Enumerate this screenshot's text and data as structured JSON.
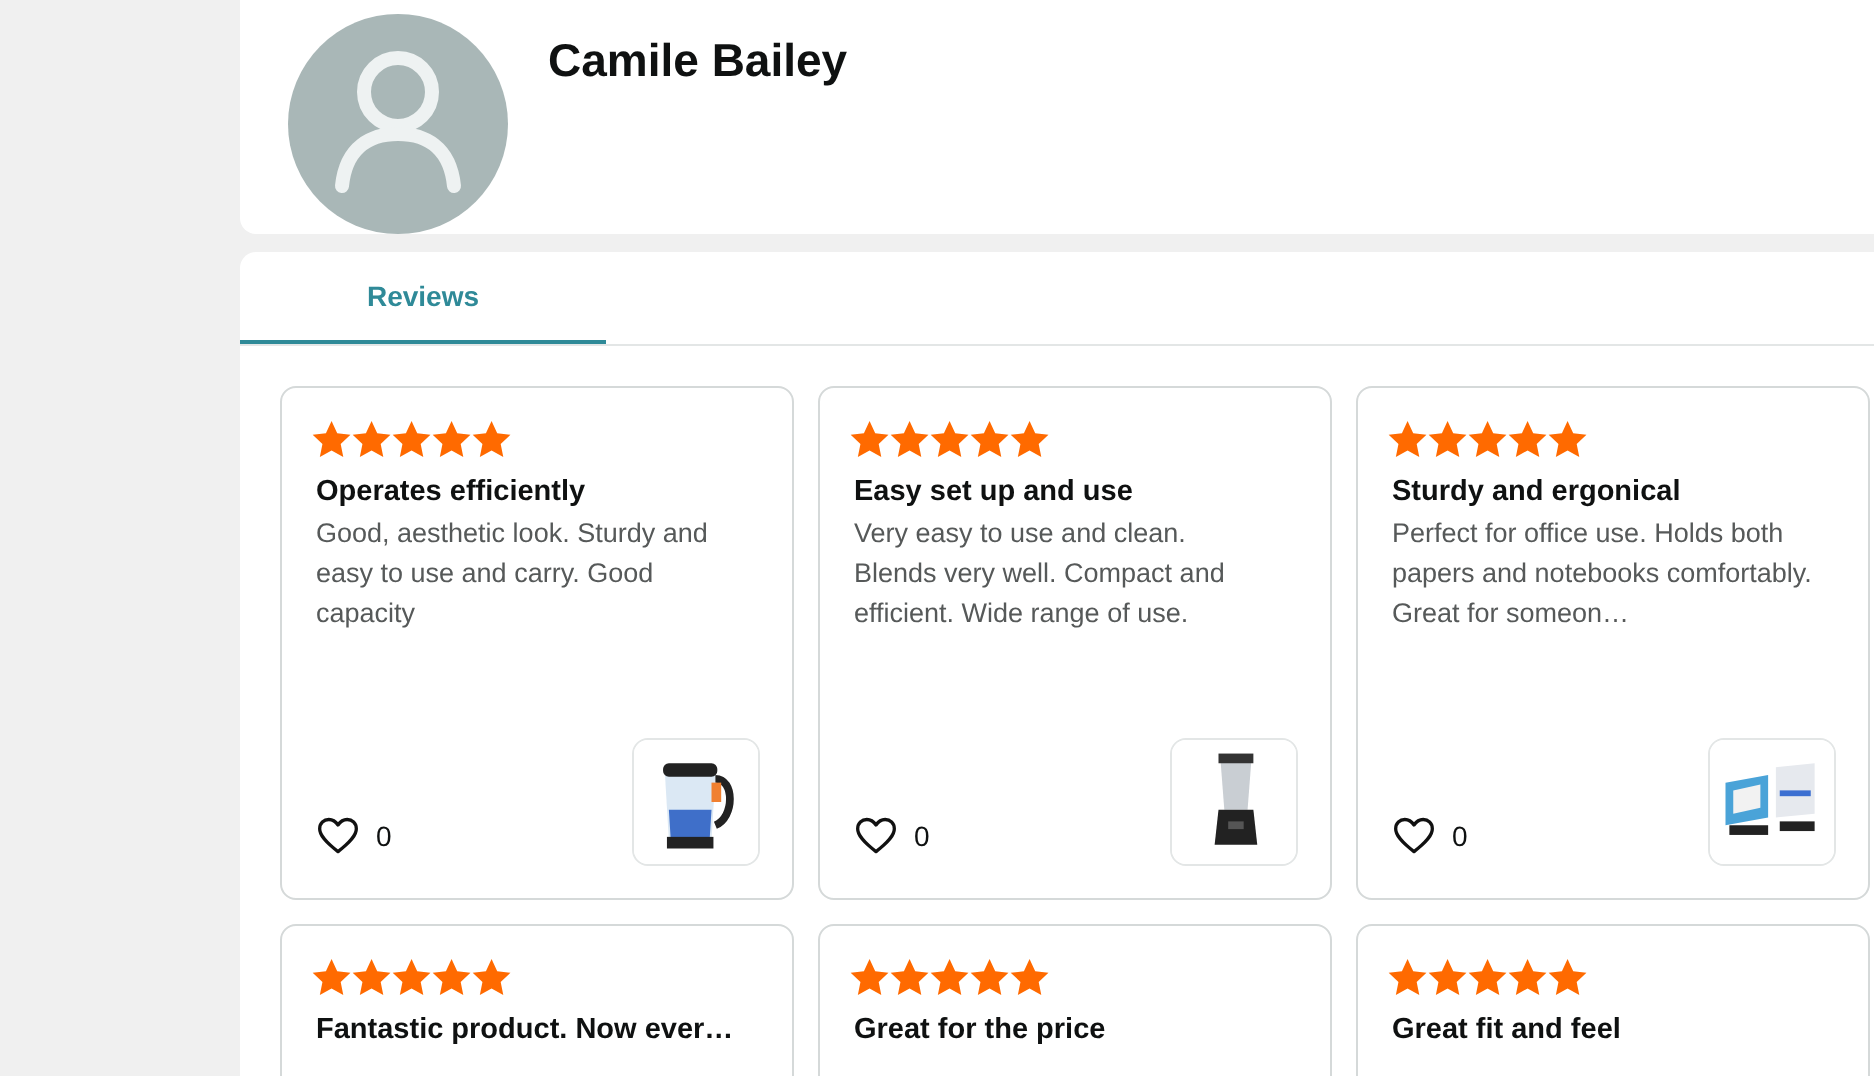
{
  "profile": {
    "name": "Camile Bailey"
  },
  "tabs": [
    {
      "label": "Reviews",
      "selected": true
    }
  ],
  "reviews": [
    {
      "stars": 5,
      "title": "Operates efficiently",
      "body": "Good, aesthetic look. Sturdy and easy to use and carry. Good capacity",
      "likes": "0"
    },
    {
      "stars": 5,
      "title": "Easy set up and use",
      "body": "Very easy to use and clean. Blends very well. Compact and efficient. Wide range of use.",
      "likes": "0"
    },
    {
      "stars": 5,
      "title": "Sturdy and ergonical",
      "body": "Perfect for office use. Holds both papers and notebooks comfortably. Great for someon…",
      "likes": "0"
    },
    {
      "stars": 5,
      "title": "Fantastic product. Now ever…"
    },
    {
      "stars": 5,
      "title": "Great for the price"
    },
    {
      "stars": 5,
      "title": "Great fit and feel"
    }
  ]
}
